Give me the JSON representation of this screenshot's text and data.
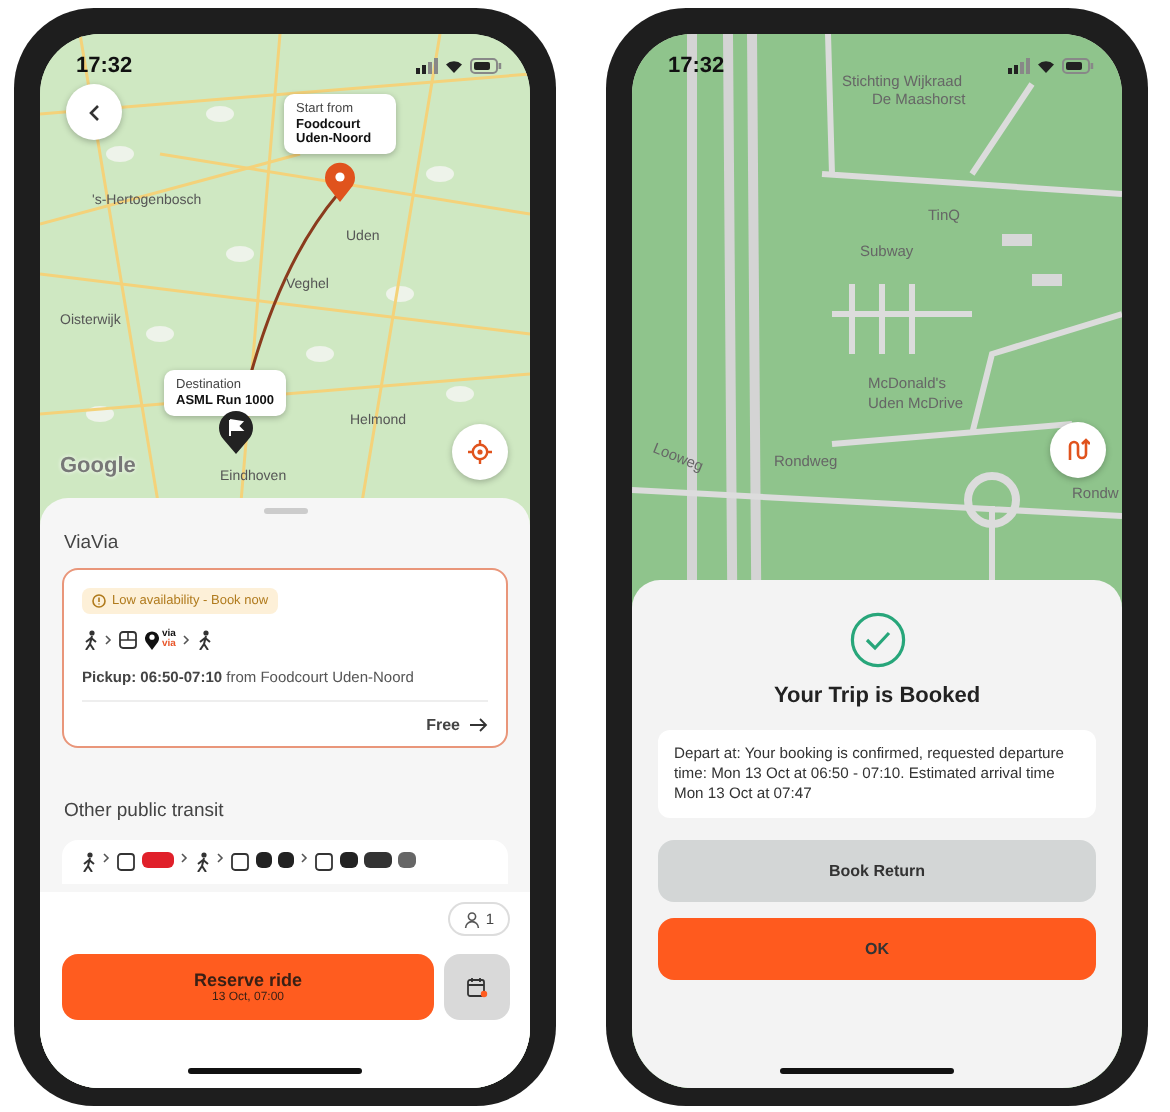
{
  "phones": [
    {
      "kind": "route",
      "status_time": "17:32",
      "map": {
        "labels": [
          "'s-Hertogenbosch",
          "Uden",
          "Veghel",
          "Oisterwijk",
          "Helmond",
          "Eindhoven"
        ],
        "attribution": "Google",
        "start": {
          "caption": "Start from",
          "place": "Foodcourt Uden-Noord"
        },
        "destination": {
          "caption": "Destination",
          "place": "ASML Run 1000"
        }
      },
      "sheet": {
        "section": "ViaVia",
        "option": {
          "badge": "Low availability - Book now",
          "logo_top": "via",
          "logo_bottom": "via",
          "pickup": "**Pickup: 06:50-07:10** from Foodcourt Uden-Noord",
          "price": "Free"
        },
        "other_section": "Other public transit"
      },
      "footer": {
        "passengers": "1",
        "reserve_label": "Reserve ride",
        "reserve_time": "13 Oct, 07:00"
      }
    },
    {
      "kind": "booked",
      "status_time": "17:32",
      "map": {
        "labels": [
          "Stichting Wijkraad",
          "De Maashorst",
          "TinQ",
          "Subway",
          "McDonald's",
          "Uden McDrive",
          "Rondweg",
          "Rondw",
          "Looweg"
        ]
      },
      "dialog": {
        "title": "Your Trip is Booked",
        "message": "Depart at: Your booking is confirmed, requested departure time: Mon 13 Oct at 06:50 - 07:10. Estimated arrival time Mon 13 Oct at 07:47",
        "buttons": [
          {
            "label": "Book Return",
            "kind": "secondary"
          },
          {
            "label": "OK",
            "kind": "primary"
          }
        ]
      }
    }
  ]
}
